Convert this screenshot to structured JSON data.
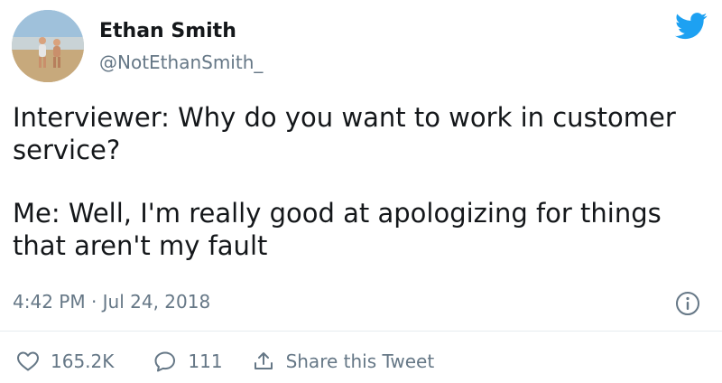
{
  "author": {
    "name": "Ethan Smith",
    "handle": "@NotEthanSmith_",
    "avatar_icon": "profile-photo"
  },
  "tweet": {
    "paragraphs": [
      "Interviewer: Why do you want to work in customer service?",
      "Me: Well, I'm really good at apologizing for things that aren't my fault"
    ],
    "timestamp": "4:42 PM · Jul 24, 2018"
  },
  "actions": {
    "likes": "165.2K",
    "replies": "111",
    "share_label": "Share this Tweet"
  },
  "icons": {
    "brand": "twitter-bird-icon",
    "info": "info-icon",
    "like": "heart-icon",
    "reply": "comment-icon",
    "share": "share-icon"
  },
  "colors": {
    "brand": "#1da1f2",
    "text": "#14171a",
    "secondary": "#657786",
    "divider": "#e6ecf0"
  }
}
